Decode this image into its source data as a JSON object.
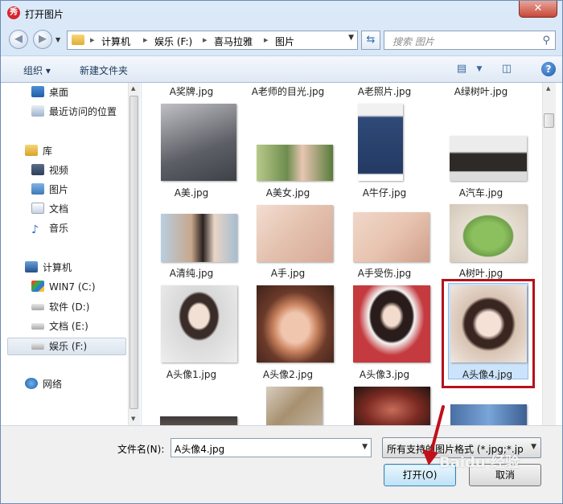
{
  "window": {
    "title": "打开图片",
    "app_icon_label": "秀"
  },
  "nav": {
    "breadcrumbs": [
      "计算机",
      "娱乐 (F:)",
      "喜马拉雅",
      "图片"
    ],
    "search_placeholder": "搜索 图片"
  },
  "toolbar": {
    "organize": "组织 ▾",
    "new_folder": "新建文件夹"
  },
  "sidebar": {
    "favorites": [
      {
        "label": "桌面"
      },
      {
        "label": "最近访问的位置"
      }
    ],
    "libraries_header": "库",
    "libraries": [
      {
        "label": "视频"
      },
      {
        "label": "图片"
      },
      {
        "label": "文档"
      },
      {
        "label": "音乐"
      }
    ],
    "computer_header": "计算机",
    "drives": [
      {
        "label": "WIN7 (C:)"
      },
      {
        "label": "软件 (D:)"
      },
      {
        "label": "文档 (E:)"
      },
      {
        "label": "娱乐 (F:)"
      }
    ],
    "network_header": "网络",
    "selected": "娱乐 (F:)"
  },
  "files": {
    "top_row": [
      "A奖牌.jpg",
      "A老师的目光.jpg",
      "A老照片.jpg",
      "A绿树叶.jpg"
    ],
    "rows": [
      [
        "A美.jpg",
        "A美女.jpg",
        "A牛仔.jpg",
        "A汽车.jpg"
      ],
      [
        "A清纯.jpg",
        "A手.jpg",
        "A手受伤.jpg",
        "A树叶.jpg"
      ],
      [
        "A头像1.jpg",
        "A头像2.jpg",
        "A头像3.jpg",
        "A头像4.jpg"
      ]
    ],
    "selected": "A头像4.jpg",
    "thumb_colors": {
      "a_mei": "#7a7c82",
      "a_meinv": "#6d8d4e",
      "a_niuzai": "#2f4a78",
      "a_qiche": "#2e2a28",
      "a_qingchun": "#c7a78d",
      "a_shou": "#e3c0ad",
      "a_shoushoushang": "#e8c4b0",
      "a_shuye": "#6fa04a",
      "a_touxiang1": "#d8d8d8",
      "a_touxiang2": "#c9825e",
      "a_touxiang3": "#c43a3e",
      "a_touxiang4": "#d8c3b3"
    }
  },
  "footer": {
    "filename_label": "文件名(N):",
    "filename_value": "A头像4.jpg",
    "filter_value": "所有支持的图片格式 (*.jpg;*.jp",
    "open_button": "打开(O)",
    "cancel_button": "取消"
  },
  "watermark": "Baidu 经验"
}
